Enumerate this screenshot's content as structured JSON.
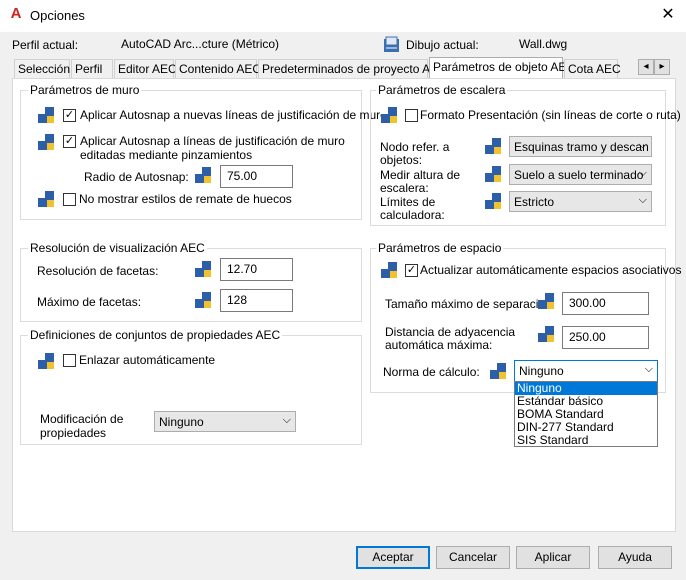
{
  "window": {
    "title": "Opciones",
    "close_glyph": "✕",
    "app_icon_letter": "A"
  },
  "profile": {
    "current_label": "Perfil actual:",
    "current_value": "AutoCAD Arc...cture (Métrico)",
    "drawing_label": "Dibujo actual:",
    "drawing_value": "Wall.dwg"
  },
  "tabs": [
    "Selección",
    "Perfil",
    "Editor AEC",
    "Contenido AEC",
    "Predeterminados de proyecto AEC",
    "Parámetros de objeto AEC",
    "Cota AEC"
  ],
  "tab_nav": {
    "left": "◂",
    "right": "▸"
  },
  "wall": {
    "title": "Parámetros de muro",
    "autosnap_new": "Aplicar Autosnap a nuevas líneas de justificación de muro",
    "autosnap_grip_line1": "Aplicar Autosnap a líneas de justificación de muro",
    "autosnap_grip_line2": "editadas mediante pinzamientos",
    "radius_label": "Radio de Autosnap:",
    "radius_value": "75.00",
    "no_endcap": "No mostrar estilos de remate de huecos"
  },
  "resolution": {
    "title": "Resolución de visualización AEC",
    "facet_res_label": "Resolución de facetas:",
    "facet_res_value": "12.70",
    "facet_max_label": "Máximo de facetas:",
    "facet_max_value": "128"
  },
  "propsets": {
    "title": "Definiciones de conjuntos de propiedades AEC",
    "auto_attach": "Enlazar automáticamente",
    "mod_label_line1": "Modificación de",
    "mod_label_line2": "propiedades",
    "mod_value": "Ninguno"
  },
  "stair": {
    "title": "Parámetros de escalera",
    "presentation": "Formato Presentación (sin líneas de corte o ruta)",
    "node_label_line1": "Nodo refer. a",
    "node_label_line2": "objetos:",
    "node_value": "Esquinas tramo y descan",
    "measure_label_line1": "Medir altura de",
    "measure_label_line2": "escalera:",
    "measure_value": "Suelo a suelo terminado",
    "limits_label_line1": "Límites de",
    "limits_label_line2": "calculadora:",
    "limits_value": "Estricto"
  },
  "space": {
    "title": "Parámetros de espacio",
    "auto_update": "Actualizar automáticamente espacios asociativos",
    "max_sep_label": "Tamaño máximo de separación:",
    "max_sep_value": "300.00",
    "adj_label_line1": "Distancia de adyacencia",
    "adj_label_line2": "automática máxima:",
    "adj_value": "250.00",
    "calc_label": "Norma de cálculo:",
    "calc_value": "Ninguno",
    "calc_options": [
      "Ninguno",
      "Estándar básico",
      "BOMA Standard",
      "DIN-277 Standard",
      "SIS Standard"
    ]
  },
  "buttons": {
    "ok": "Aceptar",
    "cancel": "Cancelar",
    "apply": "Aplicar",
    "help": "Ayuda"
  },
  "colors": {
    "accent": "#0078d7",
    "app_icon": "#d22020"
  }
}
